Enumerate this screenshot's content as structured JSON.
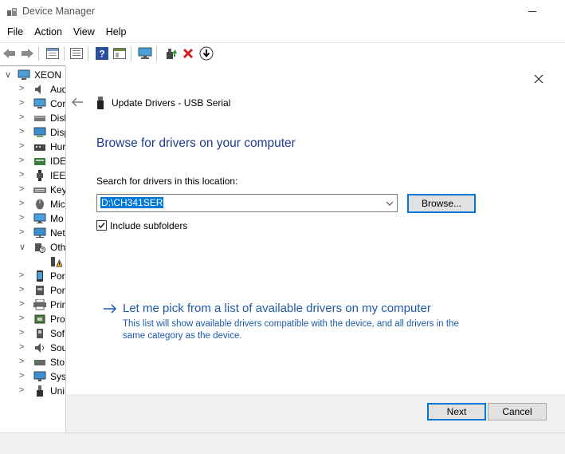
{
  "window": {
    "title": "Device Manager"
  },
  "menubar": {
    "items": [
      "File",
      "Action",
      "View",
      "Help"
    ]
  },
  "toolbar": {
    "icons": [
      "back-icon",
      "forward-icon",
      "properties-icon",
      "details-icon",
      "help-icon",
      "pane-icon",
      "scan-hardware-icon",
      "update-driver-icon",
      "uninstall-icon",
      "disable-device-icon"
    ]
  },
  "tree": {
    "root": "XEON",
    "items": [
      {
        "label": "Aud",
        "icon": "audio-icon",
        "state": "collapsed"
      },
      {
        "label": "Cor",
        "icon": "computer-icon",
        "state": "collapsed"
      },
      {
        "label": "Disk",
        "icon": "disk-drive-icon",
        "state": "collapsed"
      },
      {
        "label": "Disp",
        "icon": "display-adapter-icon",
        "state": "collapsed"
      },
      {
        "label": "Hur",
        "icon": "hid-icon",
        "state": "collapsed"
      },
      {
        "label": "IDE",
        "icon": "ide-controller-icon",
        "state": "collapsed"
      },
      {
        "label": "IEEE",
        "icon": "ieee1394-icon",
        "state": "collapsed"
      },
      {
        "label": "Key",
        "icon": "keyboard-icon",
        "state": "collapsed"
      },
      {
        "label": "Mic",
        "icon": "mouse-icon",
        "state": "collapsed"
      },
      {
        "label": "Mo",
        "icon": "monitor-icon",
        "state": "collapsed"
      },
      {
        "label": "Net",
        "icon": "network-adapter-icon",
        "state": "collapsed"
      },
      {
        "label": "Oth",
        "icon": "other-devices-icon",
        "state": "expanded"
      },
      {
        "label": "",
        "icon": "warning-device-icon",
        "state": "child"
      },
      {
        "label": "Por",
        "icon": "portable-device-icon",
        "state": "collapsed"
      },
      {
        "label": "Por",
        "icon": "ports-icon",
        "state": "collapsed"
      },
      {
        "label": "Prin",
        "icon": "printer-icon",
        "state": "collapsed"
      },
      {
        "label": "Pro",
        "icon": "processor-icon",
        "state": "collapsed"
      },
      {
        "label": "Sof",
        "icon": "software-device-icon",
        "state": "collapsed"
      },
      {
        "label": "Sou",
        "icon": "sound-icon",
        "state": "collapsed"
      },
      {
        "label": "Sto",
        "icon": "storage-controller-icon",
        "state": "collapsed"
      },
      {
        "label": "Syst",
        "icon": "system-device-icon",
        "state": "collapsed"
      },
      {
        "label": "Uni",
        "icon": "usb-controller-icon",
        "state": "collapsed"
      }
    ]
  },
  "dialog": {
    "title": "Update Drivers - USB Serial",
    "heading": "Browse for drivers on your computer",
    "search_label": "Search for drivers in this location:",
    "path_value": "D:\\CH341SER",
    "browse_label": "Browse...",
    "include_subfolders_label": "Include subfolders",
    "include_subfolders_checked": true,
    "pick_link": "Let me pick from a list of available drivers on my computer",
    "pick_desc": "This list will show available drivers compatible with the device, and all drivers in the same category as the device.",
    "next_label": "Next",
    "cancel_label": "Cancel"
  },
  "colors": {
    "accent": "#0078d7",
    "heading": "#1e3d8f",
    "link": "#1e5aa8",
    "footer": "#f0f0f0"
  }
}
